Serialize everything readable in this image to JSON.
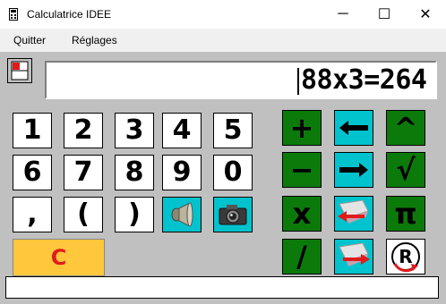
{
  "window": {
    "title": "Calculatrice IDEE",
    "minimize": "─",
    "maximize": "☐",
    "close": "✕"
  },
  "menu": {
    "quit": "Quitter",
    "settings": "Réglages"
  },
  "display": {
    "value": "88x3=264"
  },
  "keys": {
    "row1": [
      "1",
      "2",
      "3",
      "4",
      "5"
    ],
    "row2": [
      "6",
      "7",
      "8",
      "9",
      "0"
    ],
    "row3": [
      ",",
      "(",
      ")"
    ],
    "clear": "C",
    "plus": "+",
    "minus": "−",
    "times": "x",
    "divide": "/",
    "power": "^",
    "root": "√",
    "pi": "π",
    "recall": "R"
  },
  "icons": {
    "sound": "speaker-icon",
    "camera": "camera-icon",
    "left_arrow": "arrow-left-icon",
    "right_arrow": "arrow-right-icon",
    "erase_back": "erase-back-icon",
    "erase_forward": "erase-forward-icon",
    "memory": "memory-icon"
  },
  "colors": {
    "green": "#0b7a0b",
    "cyan": "#00c3cd",
    "orange": "#ffc73c",
    "red": "#e01b1b"
  }
}
